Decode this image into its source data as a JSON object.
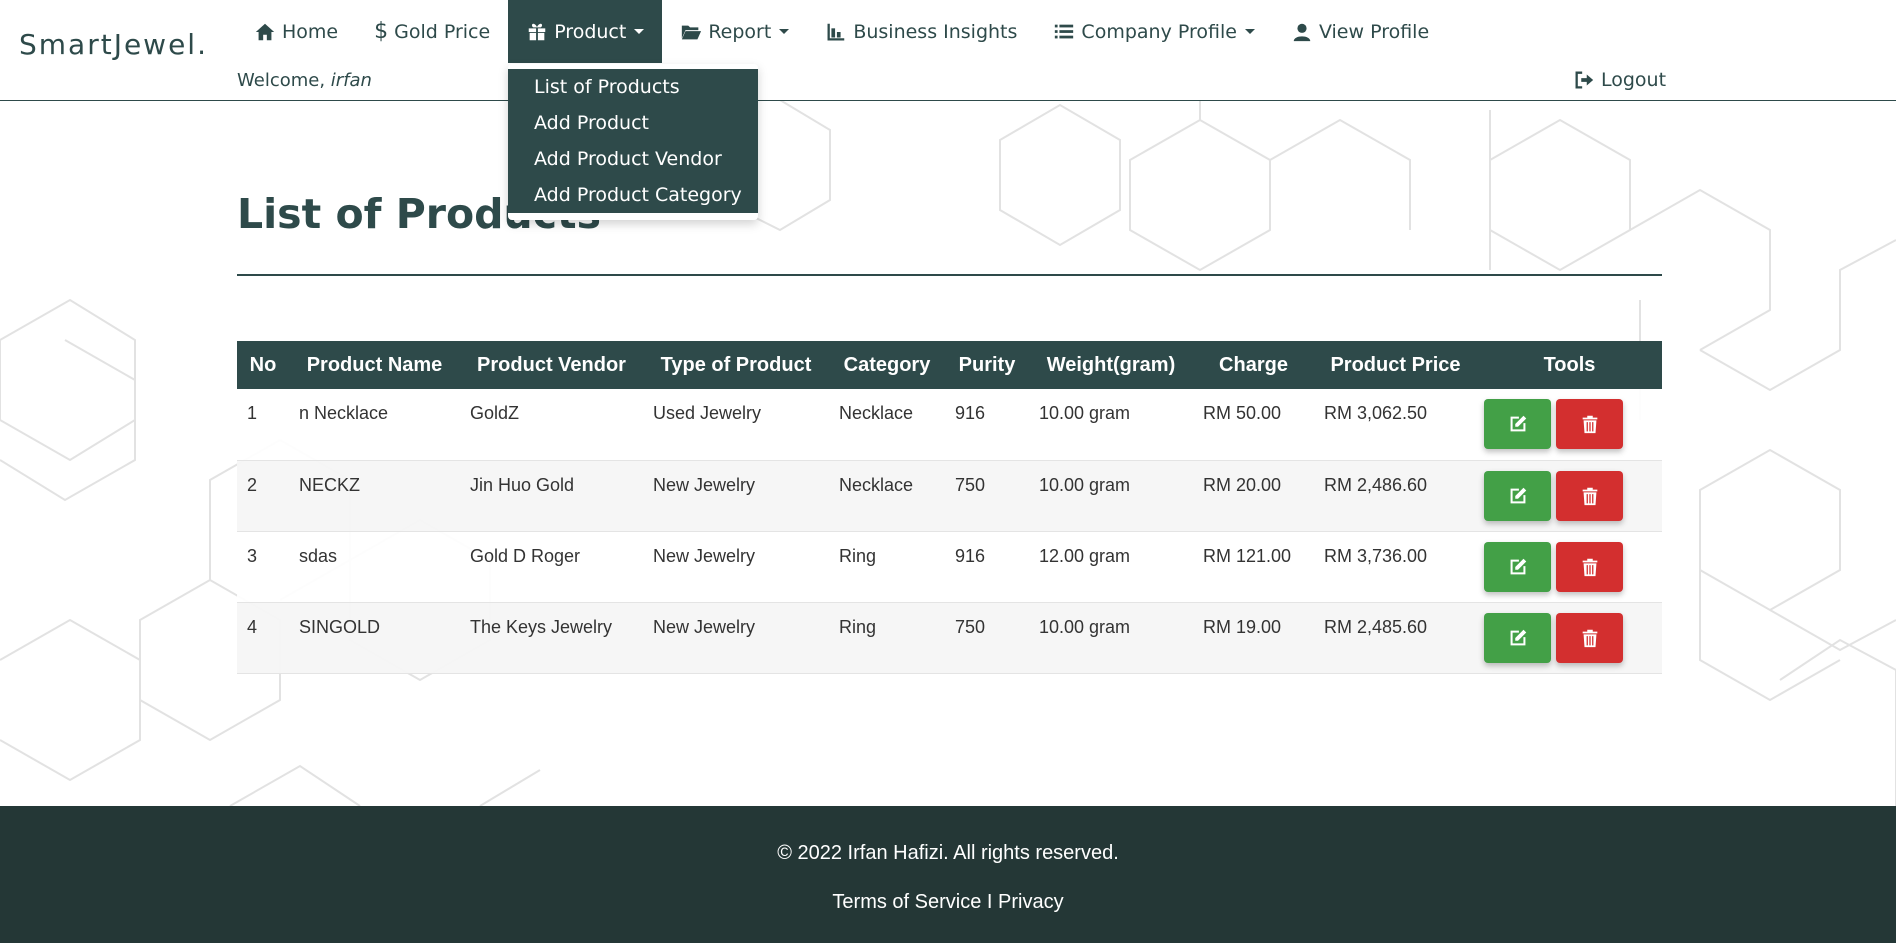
{
  "brand": "SmartJewel.",
  "nav": {
    "home": "Home",
    "gold_price": "Gold Price",
    "product": "Product",
    "report": "Report",
    "business_insights": "Business Insights",
    "company_profile": "Company Profile",
    "view_profile": "View Profile"
  },
  "welcome": {
    "prefix": "Welcome, ",
    "user": "irfan"
  },
  "logout": "Logout",
  "dropdown": {
    "items": [
      "List of Products",
      "Add Product",
      "Add Product Vendor",
      "Add Product Category"
    ]
  },
  "page_title": "List of Products",
  "table": {
    "headers": [
      "No",
      "Product Name",
      "Product Vendor",
      "Type of Product",
      "Category",
      "Purity",
      "Weight(gram)",
      "Charge",
      "Product Price",
      "Tools"
    ],
    "rows": [
      [
        "1",
        "n Necklace",
        "GoldZ",
        "Used Jewelry",
        "Necklace",
        "916",
        "10.00 gram",
        "RM 50.00",
        "RM 3,062.50"
      ],
      [
        "2",
        "NECKZ",
        "Jin Huo Gold",
        "New Jewelry",
        "Necklace",
        "750",
        "10.00 gram",
        "RM 20.00",
        "RM 2,486.60"
      ],
      [
        "3",
        "sdas",
        "Gold D Roger",
        "New Jewelry",
        "Ring",
        "916",
        "12.00 gram",
        "RM 121.00",
        "RM 3,736.00"
      ],
      [
        "4",
        "SINGOLD",
        "The Keys Jewelry",
        "New Jewelry",
        "Ring",
        "750",
        "10.00 gram",
        "RM 19.00",
        "RM 2,485.60"
      ]
    ]
  },
  "footer": {
    "copyright": "© 2022 Irfan Hafizi. All rights reserved.",
    "terms": "Terms of Service",
    "separator": " I ",
    "privacy": "Privacy"
  },
  "colors": {
    "primary": "#2e4a4a",
    "footer_bg": "#243736",
    "edit": "#43a047",
    "delete": "#d32f2f"
  }
}
